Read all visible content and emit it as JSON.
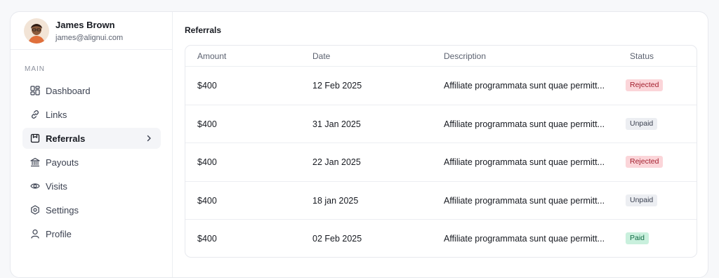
{
  "user": {
    "name": "James Brown",
    "email": "james@alignui.com"
  },
  "sidebar": {
    "section": "MAIN",
    "items": [
      {
        "label": "Dashboard",
        "icon": "dashboard-icon",
        "active": false
      },
      {
        "label": "Links",
        "icon": "link-icon",
        "active": false
      },
      {
        "label": "Referrals",
        "icon": "referrals-icon",
        "active": true
      },
      {
        "label": "Payouts",
        "icon": "bank-icon",
        "active": false
      },
      {
        "label": "Visits",
        "icon": "eye-icon",
        "active": false
      },
      {
        "label": "Settings",
        "icon": "gear-icon",
        "active": false
      },
      {
        "label": "Profile",
        "icon": "user-icon",
        "active": false
      }
    ]
  },
  "main": {
    "title": "Referrals",
    "columns": {
      "amount": "Amount",
      "date": "Date",
      "description": "Description",
      "status": "Status"
    },
    "rows": [
      {
        "amount": "$400",
        "date": "12 Feb 2025",
        "description": "Affiliate programmata sunt quae permitt...",
        "status": "Rejected"
      },
      {
        "amount": "$400",
        "date": "31 Jan 2025",
        "description": "Affiliate programmata sunt quae permitt...",
        "status": "Unpaid"
      },
      {
        "amount": "$400",
        "date": "22 Jan 2025",
        "description": "Affiliate programmata sunt quae permitt...",
        "status": "Rejected"
      },
      {
        "amount": "$400",
        "date": "18 jan 2025",
        "description": "Affiliate programmata sunt quae permitt...",
        "status": "Unpaid"
      },
      {
        "amount": "$400",
        "date": "02 Feb 2025",
        "description": "Affiliate programmata sunt quae permitt...",
        "status": "Paid"
      }
    ]
  },
  "colors": {
    "rejected_bg": "#fbd5d9",
    "unpaid_bg": "#eceef2",
    "paid_bg": "#c9f0dd",
    "active_indicator": "#171a21"
  }
}
